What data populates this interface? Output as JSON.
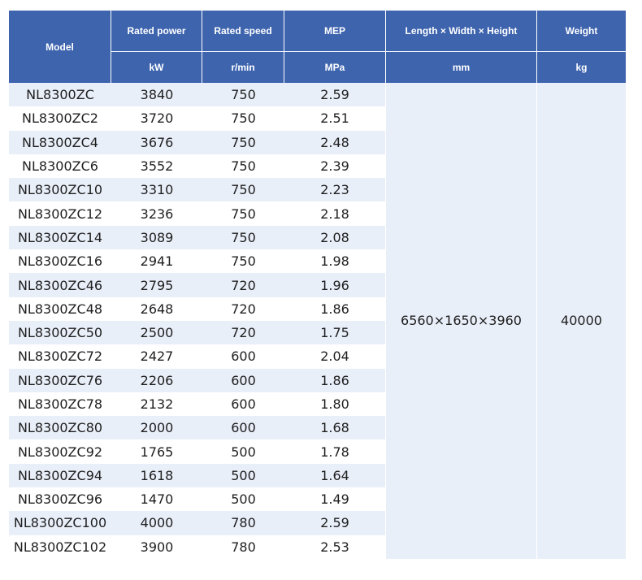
{
  "headers": {
    "model": "Model",
    "rated_power": "Rated power",
    "rated_speed": "Rated speed",
    "mep": "MEP",
    "dimensions": "Length × Width × Height",
    "weight": "Weight"
  },
  "units": {
    "rated_power": "kW",
    "rated_speed": "r/min",
    "mep": "MPa",
    "dimensions": "mm",
    "weight": "kg"
  },
  "rows": [
    {
      "model": "NL8300ZC",
      "power": "3840",
      "speed": "750",
      "mep": "2.59"
    },
    {
      "model": "NL8300ZC2",
      "power": "3720",
      "speed": "750",
      "mep": "2.51"
    },
    {
      "model": "NL8300ZC4",
      "power": "3676",
      "speed": "750",
      "mep": "2.48"
    },
    {
      "model": "NL8300ZC6",
      "power": "3552",
      "speed": "750",
      "mep": "2.39"
    },
    {
      "model": "NL8300ZC10",
      "power": "3310",
      "speed": "750",
      "mep": "2.23"
    },
    {
      "model": "NL8300ZC12",
      "power": "3236",
      "speed": "750",
      "mep": "2.18"
    },
    {
      "model": "NL8300ZC14",
      "power": "3089",
      "speed": "750",
      "mep": "2.08"
    },
    {
      "model": "NL8300ZC16",
      "power": "2941",
      "speed": "750",
      "mep": "1.98"
    },
    {
      "model": "NL8300ZC46",
      "power": "2795",
      "speed": "720",
      "mep": "1.96"
    },
    {
      "model": "NL8300ZC48",
      "power": "2648",
      "speed": "720",
      "mep": "1.86"
    },
    {
      "model": "NL8300ZC50",
      "power": "2500",
      "speed": "720",
      "mep": "1.75"
    },
    {
      "model": "NL8300ZC72",
      "power": "2427",
      "speed": "600",
      "mep": "2.04"
    },
    {
      "model": "NL8300ZC76",
      "power": "2206",
      "speed": "600",
      "mep": "1.86"
    },
    {
      "model": "NL8300ZC78",
      "power": "2132",
      "speed": "600",
      "mep": "1.80"
    },
    {
      "model": "NL8300ZC80",
      "power": "2000",
      "speed": "600",
      "mep": "1.68"
    },
    {
      "model": "NL8300ZC92",
      "power": "1765",
      "speed": "500",
      "mep": "1.78"
    },
    {
      "model": "NL8300ZC94",
      "power": "1618",
      "speed": "500",
      "mep": "1.64"
    },
    {
      "model": "NL8300ZC96",
      "power": "1470",
      "speed": "500",
      "mep": "1.49"
    },
    {
      "model": "NL8300ZC100",
      "power": "4000",
      "speed": "780",
      "mep": "2.59"
    },
    {
      "model": "NL8300ZC102",
      "power": "3900",
      "speed": "780",
      "mep": "2.53"
    }
  ],
  "shared": {
    "dimensions": "6560×1650×3960",
    "weight": "40000"
  }
}
